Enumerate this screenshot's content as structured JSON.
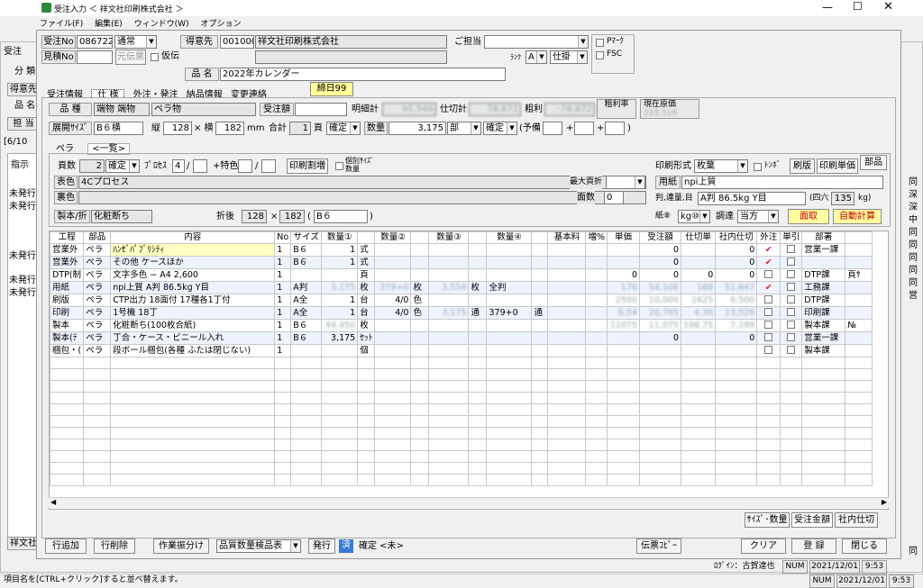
{
  "window": {
    "title": "受注入力 ＜ 祥文社印刷株式会社 ＞",
    "menus": [
      "ファイル(F)",
      "編集(E)",
      "ウィンドウ(W)",
      "オプション"
    ]
  },
  "header": {
    "order_no_label": "受注No",
    "order_no": "086722",
    "order_type": "通常",
    "estimate_no_label": "見積No",
    "estimate_source_btn": "元伝票",
    "provisional_label": "仮伝",
    "client_label": "得意先",
    "client_code": "001000",
    "client_name": "祥文社印刷株式会社",
    "contact_label": "ご担当",
    "rank_label": "ﾗﾝｸ",
    "rank": "A",
    "binding": "仕掛",
    "pmark": "Pﾏｰｸ",
    "fsc": "FSC",
    "product_label": "品 名",
    "product_name": "2022年カレンダー"
  },
  "tabs": [
    "受注情報",
    "仕 様",
    "外注・発注",
    "納品情報",
    "変更連絡"
  ],
  "tab_badge": "締日99",
  "spec": {
    "kind_label": "品 種",
    "kind1": "端物 端物",
    "kind2": "ペラ物",
    "order_amt_label": "受注額",
    "detail_total_label": "明細計",
    "detail_total": "95,946",
    "cut_label": "仕切計",
    "cut_total": "78,872",
    "profit_label": "粗利",
    "profit": "-78,872",
    "profit_rate_label": "粗利率",
    "cost_label": "現在原価",
    "cost": "225,516",
    "size_label": "展開ｻｲｽﾞ",
    "size": "B６横",
    "vert_label": "縦",
    "vert": "128",
    "horiz_label": "× 横",
    "horiz": "182",
    "mm": "mm",
    "total_label": "合計",
    "pages": "1",
    "page_unit": "頁",
    "confirm1": "確定",
    "qty_label": "数量",
    "qty": "3,175",
    "qty_unit": "部",
    "confirm2": "確定",
    "spare_label": "(予備",
    "plus1": "+",
    "plus2": "+",
    "close_paren": ")"
  },
  "subtabs": [
    "ペラ",
    "<一覧>"
  ],
  "inner": {
    "pages_label": "頁数",
    "pages": "2",
    "confirm": "確定",
    "process_label": "ﾌﾟﾛｾｽ",
    "process": "4",
    "slash1": "/",
    "special_label": "+特色",
    "slash2": "/",
    "print_btn": "印刷割増",
    "indiv_label": "個別ｻｲｽﾞ\n数量",
    "front_color_label": "表色",
    "front_color": "4Cプロセス",
    "back_color_label": "裏色",
    "max_sheet_label": "最大頁折",
    "face_label": "面数",
    "face": "0",
    "bind_label": "製本/折",
    "bind": "化粧断ち",
    "fold_label": "折後",
    "fold_v": "128",
    "fold_x": "×",
    "fold_h": "182",
    "fold_size": "B６",
    "print_form_label": "印刷形式",
    "print_form": "枚葉",
    "tonbo_label": "ﾄﾝﾎﾞ",
    "print_btn2": "刷版",
    "unit_btn": "印刷単価",
    "bind_btn": "部品",
    "paper_label": "用紙",
    "paper": "npi上質",
    "paper_weight_label": "判,連量,目",
    "paper_weight": "A判 86.5kg Y目",
    "four_six": "(四六",
    "four_six_val": "135",
    "kg": "kg)",
    "paper_unit_label": "紙⑧",
    "paper_unit": "kg⑩",
    "procure_label": "調達",
    "procure": "当方",
    "men_btn": "面取",
    "auto_btn": "自動計算"
  },
  "table": {
    "headers": [
      "工程",
      "部品",
      "内容",
      "No",
      "サイズ",
      "数量①",
      "",
      "数量②",
      "",
      "数量③",
      "",
      "数量④",
      "",
      "基本料",
      "増%",
      "単価",
      "受注額",
      "仕切単",
      "社内仕切",
      "外注",
      "単引",
      "部署",
      ""
    ],
    "rows": [
      [
        "営業外",
        "ペラ",
        "ﾊﾝｾﾞﾊﾟﾌﾞﾘｼﾃｨ",
        "1",
        "B６",
        "1",
        "式",
        "",
        "",
        "",
        "",
        "",
        "",
        "",
        "",
        "",
        "0",
        "",
        "0",
        "✔",
        "",
        "営業一課",
        ""
      ],
      [
        "営業外",
        "ペラ",
        "その他 ケースほか",
        "1",
        "B６",
        "1",
        "式",
        "",
        "",
        "",
        "",
        "",
        "",
        "",
        "",
        "",
        "0",
        "",
        "0",
        "✔",
        "",
        "",
        ""
      ],
      [
        "DTP(制",
        "ペラ",
        "文字多色 − A4 2,600",
        "1",
        "",
        "",
        "頁",
        "",
        "",
        "",
        "",
        "",
        "",
        "",
        "",
        "0",
        "0",
        "0",
        "0",
        "",
        "",
        "DTP課",
        "頁ｻ"
      ],
      [
        "用紙",
        "ペラ",
        "npi上質 A判 86.5kg Y目",
        "1",
        "A判",
        "3,175",
        "枚",
        "379+0",
        "枚",
        "3,554",
        "枚",
        "全判",
        "",
        "",
        "",
        "176",
        "54,106",
        "168",
        "51,647",
        "✔",
        "",
        "工務課",
        ""
      ],
      [
        "刷版",
        "ペラ",
        "CTP出力 18面付 17種各1丁付",
        "1",
        "A全",
        "1",
        "台",
        "4/0",
        "色",
        "",
        "",
        "",
        "",
        "",
        "",
        "2500",
        "10,000",
        "1625",
        "6,500",
        "",
        "",
        "DTP課",
        ""
      ],
      [
        "印刷",
        "ペラ",
        "1号機 18丁",
        "1",
        "A全",
        "1",
        "台",
        "4/0",
        "色",
        "3,175",
        "通",
        "379+0",
        "通",
        "",
        "",
        "6.54",
        "20,765",
        "4.36",
        "13,526",
        "",
        "",
        "印刷課",
        ""
      ],
      [
        "製本",
        "ペラ",
        "化粧断ち(100枚合紙)",
        "1",
        "B６",
        "44,450",
        "枚",
        "",
        "",
        "",
        "",
        "",
        "",
        "",
        "",
        "11075",
        "11,075",
        "198.75",
        "7,199",
        "",
        "",
        "製本課",
        "№"
      ],
      [
        "製本(ﾃ",
        "ペラ",
        "丁合・ケース・ビニール入れ",
        "1",
        "B６",
        "3,175",
        "ｾｯﾄ",
        "",
        "",
        "",
        "",
        "",
        "",
        "",
        "",
        "",
        "0",
        "",
        "0",
        "",
        "",
        "営業一課",
        ""
      ],
      [
        "梱包・(",
        "ペラ",
        "段ボール梱包(各種 ふたは閉じない)",
        "1",
        "",
        "",
        "個",
        "",
        "",
        "",
        "",
        "",
        "",
        "",
        "",
        "",
        "",
        "",
        "",
        "",
        "",
        "製本課",
        ""
      ]
    ]
  },
  "bottom_tabs": [
    "ｻｲｽﾞ･数量",
    "受注金額",
    "社内仕切"
  ],
  "footer": {
    "add_row": "行追加",
    "del_row": "行削除",
    "assign": "作業振分け",
    "quality": "品質数量検品表",
    "issue": "発行",
    "done": "済",
    "confirm_none": "確定 <未>",
    "slip_copy": "伝票ｺﾋﾟｰ",
    "clear": "クリア",
    "register": "登 録",
    "close": "閉じる",
    "login": "ﾛｸﾞｲﾝ：古賀達也",
    "num": "NUM",
    "date": "2021/12/01",
    "time": "9:53"
  },
  "status": {
    "hint": "項目名を[CTRL+クリック]すると並べ替えます。",
    "num": "NUM",
    "date": "2021/12/01",
    "time": "9:53"
  },
  "background": {
    "left_labels": [
      "受注",
      "分 類",
      "得意先",
      "品 名",
      "担 当",
      "[6/10",
      "指示",
      "未発行",
      "未発行",
      "未発行",
      "未発行",
      "未発行",
      "祥文社"
    ],
    "right_labels": [
      "同",
      "深",
      "深",
      "中",
      "同",
      "同",
      "同",
      "同",
      "同",
      "営",
      "同"
    ]
  }
}
